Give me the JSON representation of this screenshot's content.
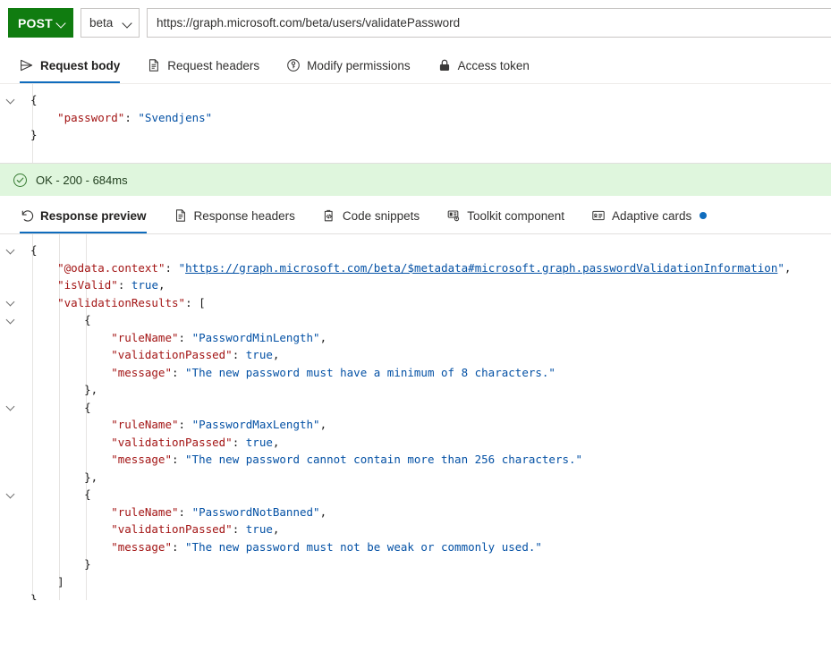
{
  "query_bar": {
    "method": "POST",
    "method_icon": "chevron-down-icon",
    "version": "beta",
    "version_icon": "chevron-down-icon",
    "url": "https://graph.microsoft.com/beta/users/validatePassword"
  },
  "request_tabs": [
    {
      "label": "Request body",
      "icon": "send-icon",
      "selected": true
    },
    {
      "label": "Request headers",
      "icon": "document-icon",
      "selected": false
    },
    {
      "label": "Modify permissions",
      "icon": "key-icon",
      "selected": false
    },
    {
      "label": "Access token",
      "icon": "lock-icon",
      "selected": false
    }
  ],
  "request_body": {
    "lines": [
      {
        "caret": true,
        "depth": 0,
        "tokens": [
          {
            "t": "p",
            "v": "{"
          }
        ]
      },
      {
        "caret": false,
        "depth": 1,
        "tokens": [
          {
            "t": "k",
            "v": "\"password\""
          },
          {
            "t": "p",
            "v": ": "
          },
          {
            "t": "s",
            "v": "\"Svendjens\""
          }
        ]
      },
      {
        "caret": false,
        "depth": 0,
        "tokens": [
          {
            "t": "p",
            "v": "}"
          }
        ]
      }
    ]
  },
  "status": {
    "icon": "check-circle-icon",
    "text": "OK - 200 - 684ms",
    "code": "200",
    "message": "OK",
    "duration": "684ms",
    "background": "#dff6dd"
  },
  "response_tabs": [
    {
      "label": "Response preview",
      "icon": "history-back-icon",
      "selected": true,
      "badge": false
    },
    {
      "label": "Response headers",
      "icon": "document-icon",
      "selected": false,
      "badge": false
    },
    {
      "label": "Code snippets",
      "icon": "code-clipboard-icon",
      "selected": false,
      "badge": false
    },
    {
      "label": "Toolkit component",
      "icon": "toolkit-gear-icon",
      "selected": false,
      "badge": false
    },
    {
      "label": "Adaptive cards",
      "icon": "card-icon",
      "selected": false,
      "badge": true
    }
  ],
  "response_body": {
    "odata_context": "https://graph.microsoft.com/beta/$metadata#microsoft.graph.passwordValidationInformation",
    "isValid": "true",
    "validationResults": [
      {
        "ruleName": "PasswordMinLength",
        "validationPassed": "true",
        "message": "The new password must have a minimum of 8 characters."
      },
      {
        "ruleName": "PasswordMaxLength",
        "validationPassed": "true",
        "message": "The new password cannot contain more than 256 characters."
      },
      {
        "ruleName": "PasswordNotBanned",
        "validationPassed": "true",
        "message": "The new password must not be weak or commonly used."
      }
    ],
    "lines": [
      {
        "caret": true,
        "depth": 0,
        "tokens": [
          {
            "t": "p",
            "v": "{"
          }
        ]
      },
      {
        "caret": false,
        "depth": 1,
        "tokens": [
          {
            "t": "k",
            "v": "\"@odata.context\""
          },
          {
            "t": "p",
            "v": ": "
          },
          {
            "t": "s",
            "v": "\""
          },
          {
            "t": "lnk",
            "v": "https://graph.microsoft.com/beta/$metadata#microsoft.graph.passwordValidationInformation"
          },
          {
            "t": "s",
            "v": "\""
          },
          {
            "t": "p",
            "v": ","
          }
        ]
      },
      {
        "caret": false,
        "depth": 1,
        "tokens": [
          {
            "t": "k",
            "v": "\"isValid\""
          },
          {
            "t": "p",
            "v": ": "
          },
          {
            "t": "b",
            "v": "true"
          },
          {
            "t": "p",
            "v": ","
          }
        ]
      },
      {
        "caret": true,
        "depth": 1,
        "tokens": [
          {
            "t": "k",
            "v": "\"validationResults\""
          },
          {
            "t": "p",
            "v": ": ["
          }
        ]
      },
      {
        "caret": true,
        "depth": 2,
        "tokens": [
          {
            "t": "p",
            "v": "{"
          }
        ]
      },
      {
        "caret": false,
        "depth": 3,
        "tokens": [
          {
            "t": "k",
            "v": "\"ruleName\""
          },
          {
            "t": "p",
            "v": ": "
          },
          {
            "t": "s",
            "v": "\"PasswordMinLength\""
          },
          {
            "t": "p",
            "v": ","
          }
        ]
      },
      {
        "caret": false,
        "depth": 3,
        "tokens": [
          {
            "t": "k",
            "v": "\"validationPassed\""
          },
          {
            "t": "p",
            "v": ": "
          },
          {
            "t": "b",
            "v": "true"
          },
          {
            "t": "p",
            "v": ","
          }
        ]
      },
      {
        "caret": false,
        "depth": 3,
        "tokens": [
          {
            "t": "k",
            "v": "\"message\""
          },
          {
            "t": "p",
            "v": ": "
          },
          {
            "t": "s",
            "v": "\"The new password must have a minimum of 8 characters.\""
          }
        ]
      },
      {
        "caret": false,
        "depth": 2,
        "tokens": [
          {
            "t": "p",
            "v": "},"
          }
        ]
      },
      {
        "caret": true,
        "depth": 2,
        "tokens": [
          {
            "t": "p",
            "v": "{"
          }
        ]
      },
      {
        "caret": false,
        "depth": 3,
        "tokens": [
          {
            "t": "k",
            "v": "\"ruleName\""
          },
          {
            "t": "p",
            "v": ": "
          },
          {
            "t": "s",
            "v": "\"PasswordMaxLength\""
          },
          {
            "t": "p",
            "v": ","
          }
        ]
      },
      {
        "caret": false,
        "depth": 3,
        "tokens": [
          {
            "t": "k",
            "v": "\"validationPassed\""
          },
          {
            "t": "p",
            "v": ": "
          },
          {
            "t": "b",
            "v": "true"
          },
          {
            "t": "p",
            "v": ","
          }
        ]
      },
      {
        "caret": false,
        "depth": 3,
        "tokens": [
          {
            "t": "k",
            "v": "\"message\""
          },
          {
            "t": "p",
            "v": ": "
          },
          {
            "t": "s",
            "v": "\"The new password cannot contain more than 256 characters.\""
          }
        ]
      },
      {
        "caret": false,
        "depth": 2,
        "tokens": [
          {
            "t": "p",
            "v": "},"
          }
        ]
      },
      {
        "caret": true,
        "depth": 2,
        "tokens": [
          {
            "t": "p",
            "v": "{"
          }
        ]
      },
      {
        "caret": false,
        "depth": 3,
        "tokens": [
          {
            "t": "k",
            "v": "\"ruleName\""
          },
          {
            "t": "p",
            "v": ": "
          },
          {
            "t": "s",
            "v": "\"PasswordNotBanned\""
          },
          {
            "t": "p",
            "v": ","
          }
        ]
      },
      {
        "caret": false,
        "depth": 3,
        "tokens": [
          {
            "t": "k",
            "v": "\"validationPassed\""
          },
          {
            "t": "p",
            "v": ": "
          },
          {
            "t": "b",
            "v": "true"
          },
          {
            "t": "p",
            "v": ","
          }
        ]
      },
      {
        "caret": false,
        "depth": 3,
        "tokens": [
          {
            "t": "k",
            "v": "\"message\""
          },
          {
            "t": "p",
            "v": ": "
          },
          {
            "t": "s",
            "v": "\"The new password must not be weak or commonly used.\""
          }
        ]
      },
      {
        "caret": false,
        "depth": 2,
        "tokens": [
          {
            "t": "p",
            "v": "}"
          }
        ]
      },
      {
        "caret": false,
        "depth": 1,
        "tokens": [
          {
            "t": "p",
            "v": "]"
          }
        ]
      },
      {
        "caret": false,
        "depth": 0,
        "tokens": [
          {
            "t": "p",
            "v": "}"
          }
        ]
      }
    ]
  },
  "colors": {
    "method_green": "#107c10",
    "accent_blue": "#0f6cbd",
    "status_green_bg": "#dff6dd",
    "json_key": "#a31515",
    "json_string": "#0451a5"
  }
}
